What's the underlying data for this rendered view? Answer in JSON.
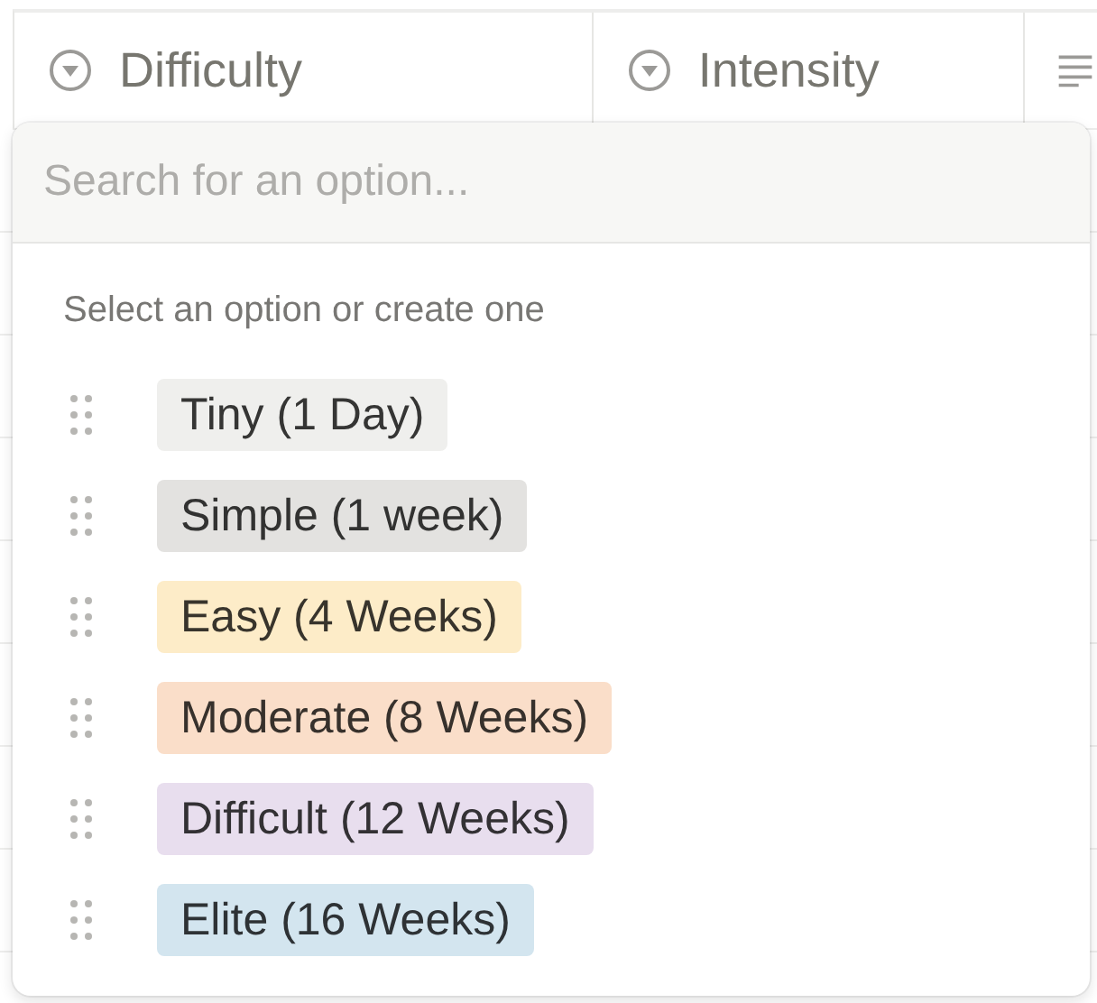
{
  "table": {
    "columns": [
      {
        "label": "Difficulty",
        "kind": "select"
      },
      {
        "label": "Intensity",
        "kind": "select"
      },
      {
        "kind": "text"
      }
    ]
  },
  "dropdown": {
    "search": {
      "placeholder": "Search for an option..."
    },
    "heading": "Select an option or create one",
    "options": [
      {
        "label": "Tiny (1 Day)",
        "color": "#efefed"
      },
      {
        "label": "Simple (1 week)",
        "color": "#e3e2e0"
      },
      {
        "label": "Easy (4 Weeks)",
        "color": "#fdecc8"
      },
      {
        "label": "Moderate (8 Weeks)",
        "color": "#fadec9"
      },
      {
        "label": "Difficult (12 Weeks)",
        "color": "#e8deee"
      },
      {
        "label": "Elite (16 Weeks)",
        "color": "#d3e5ef"
      }
    ]
  }
}
